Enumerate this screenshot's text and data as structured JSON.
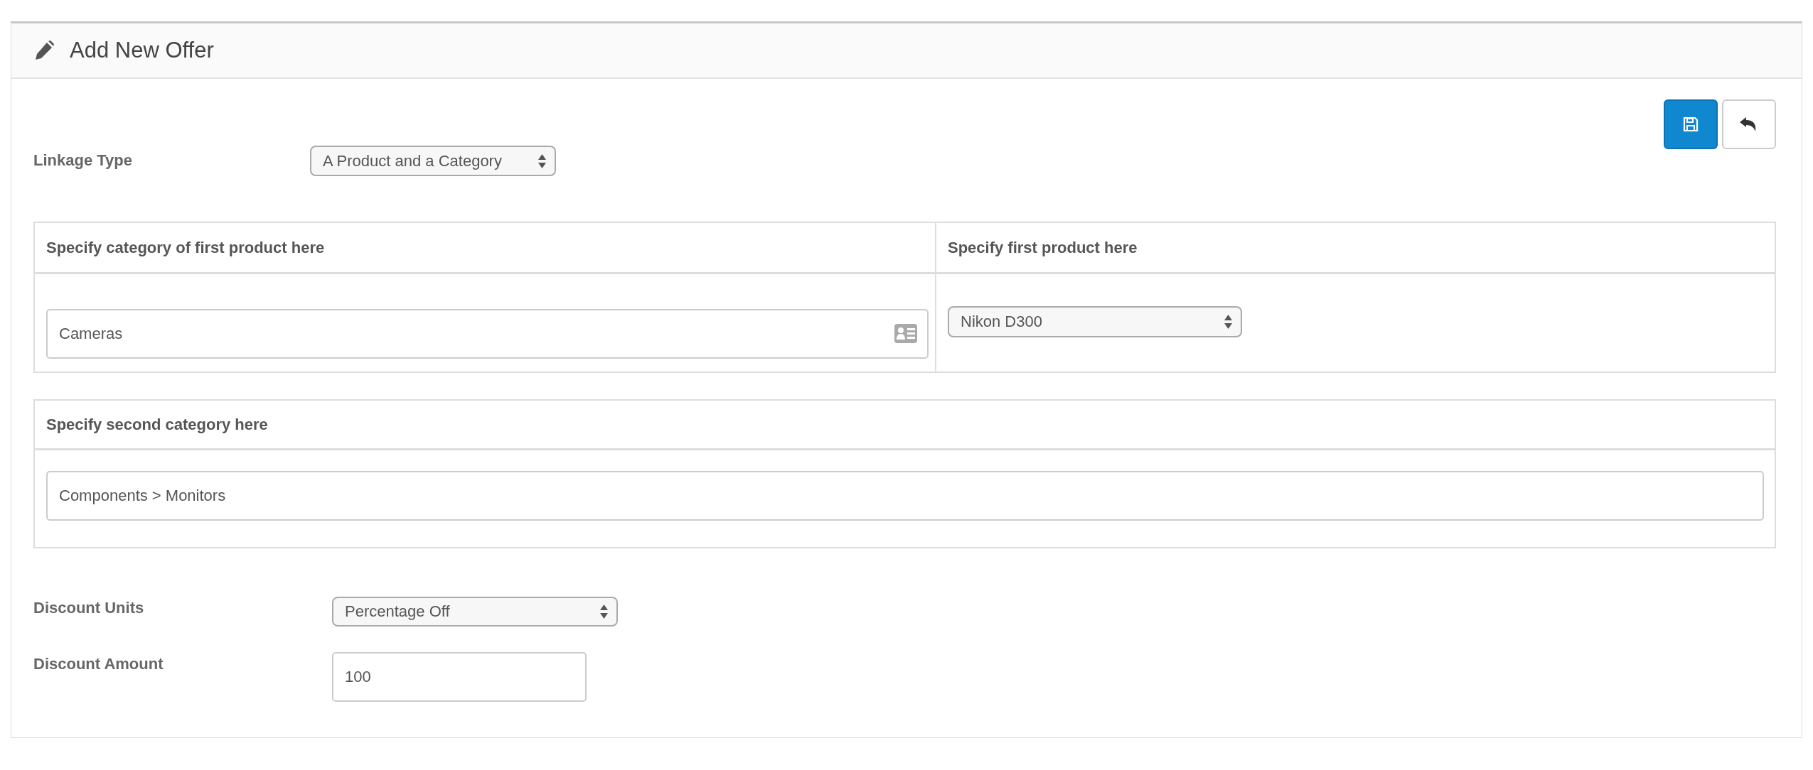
{
  "panel": {
    "title": "Add New Offer"
  },
  "actions": [
    {
      "kind": "save"
    },
    {
      "kind": "back"
    }
  ],
  "linkage_type": {
    "label": "Linkage Type",
    "value": "A Product and a Category"
  },
  "first_table": {
    "columns": [
      "Specify category of first product here",
      "Specify first product here"
    ],
    "category_input": {
      "value": "Cameras"
    },
    "product_select": {
      "value": "Nikon D300"
    }
  },
  "second_table": {
    "column": "Specify second category here",
    "category_input": {
      "value": "Components > Monitors"
    }
  },
  "discount_units": {
    "label": "Discount Units",
    "value": "Percentage Off"
  },
  "discount_amount": {
    "label": "Discount Amount",
    "value": "100"
  }
}
